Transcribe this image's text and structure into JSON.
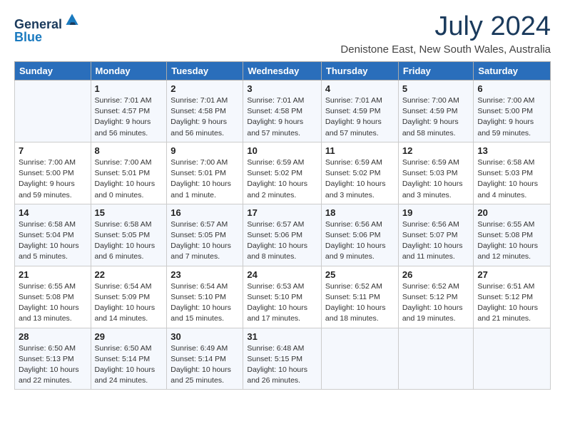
{
  "header": {
    "logo_line1": "General",
    "logo_line2": "Blue",
    "month_title": "July 2024",
    "location": "Denistone East, New South Wales, Australia"
  },
  "weekdays": [
    "Sunday",
    "Monday",
    "Tuesday",
    "Wednesday",
    "Thursday",
    "Friday",
    "Saturday"
  ],
  "weeks": [
    [
      {
        "day": "",
        "sunrise": "",
        "sunset": "",
        "daylight": ""
      },
      {
        "day": "1",
        "sunrise": "Sunrise: 7:01 AM",
        "sunset": "Sunset: 4:57 PM",
        "daylight": "Daylight: 9 hours and 56 minutes."
      },
      {
        "day": "2",
        "sunrise": "Sunrise: 7:01 AM",
        "sunset": "Sunset: 4:58 PM",
        "daylight": "Daylight: 9 hours and 56 minutes."
      },
      {
        "day": "3",
        "sunrise": "Sunrise: 7:01 AM",
        "sunset": "Sunset: 4:58 PM",
        "daylight": "Daylight: 9 hours and 57 minutes."
      },
      {
        "day": "4",
        "sunrise": "Sunrise: 7:01 AM",
        "sunset": "Sunset: 4:59 PM",
        "daylight": "Daylight: 9 hours and 57 minutes."
      },
      {
        "day": "5",
        "sunrise": "Sunrise: 7:00 AM",
        "sunset": "Sunset: 4:59 PM",
        "daylight": "Daylight: 9 hours and 58 minutes."
      },
      {
        "day": "6",
        "sunrise": "Sunrise: 7:00 AM",
        "sunset": "Sunset: 5:00 PM",
        "daylight": "Daylight: 9 hours and 59 minutes."
      }
    ],
    [
      {
        "day": "7",
        "sunrise": "Sunrise: 7:00 AM",
        "sunset": "Sunset: 5:00 PM",
        "daylight": "Daylight: 9 hours and 59 minutes."
      },
      {
        "day": "8",
        "sunrise": "Sunrise: 7:00 AM",
        "sunset": "Sunset: 5:01 PM",
        "daylight": "Daylight: 10 hours and 0 minutes."
      },
      {
        "day": "9",
        "sunrise": "Sunrise: 7:00 AM",
        "sunset": "Sunset: 5:01 PM",
        "daylight": "Daylight: 10 hours and 1 minute."
      },
      {
        "day": "10",
        "sunrise": "Sunrise: 6:59 AM",
        "sunset": "Sunset: 5:02 PM",
        "daylight": "Daylight: 10 hours and 2 minutes."
      },
      {
        "day": "11",
        "sunrise": "Sunrise: 6:59 AM",
        "sunset": "Sunset: 5:02 PM",
        "daylight": "Daylight: 10 hours and 3 minutes."
      },
      {
        "day": "12",
        "sunrise": "Sunrise: 6:59 AM",
        "sunset": "Sunset: 5:03 PM",
        "daylight": "Daylight: 10 hours and 3 minutes."
      },
      {
        "day": "13",
        "sunrise": "Sunrise: 6:58 AM",
        "sunset": "Sunset: 5:03 PM",
        "daylight": "Daylight: 10 hours and 4 minutes."
      }
    ],
    [
      {
        "day": "14",
        "sunrise": "Sunrise: 6:58 AM",
        "sunset": "Sunset: 5:04 PM",
        "daylight": "Daylight: 10 hours and 5 minutes."
      },
      {
        "day": "15",
        "sunrise": "Sunrise: 6:58 AM",
        "sunset": "Sunset: 5:05 PM",
        "daylight": "Daylight: 10 hours and 6 minutes."
      },
      {
        "day": "16",
        "sunrise": "Sunrise: 6:57 AM",
        "sunset": "Sunset: 5:05 PM",
        "daylight": "Daylight: 10 hours and 7 minutes."
      },
      {
        "day": "17",
        "sunrise": "Sunrise: 6:57 AM",
        "sunset": "Sunset: 5:06 PM",
        "daylight": "Daylight: 10 hours and 8 minutes."
      },
      {
        "day": "18",
        "sunrise": "Sunrise: 6:56 AM",
        "sunset": "Sunset: 5:06 PM",
        "daylight": "Daylight: 10 hours and 9 minutes."
      },
      {
        "day": "19",
        "sunrise": "Sunrise: 6:56 AM",
        "sunset": "Sunset: 5:07 PM",
        "daylight": "Daylight: 10 hours and 11 minutes."
      },
      {
        "day": "20",
        "sunrise": "Sunrise: 6:55 AM",
        "sunset": "Sunset: 5:08 PM",
        "daylight": "Daylight: 10 hours and 12 minutes."
      }
    ],
    [
      {
        "day": "21",
        "sunrise": "Sunrise: 6:55 AM",
        "sunset": "Sunset: 5:08 PM",
        "daylight": "Daylight: 10 hours and 13 minutes."
      },
      {
        "day": "22",
        "sunrise": "Sunrise: 6:54 AM",
        "sunset": "Sunset: 5:09 PM",
        "daylight": "Daylight: 10 hours and 14 minutes."
      },
      {
        "day": "23",
        "sunrise": "Sunrise: 6:54 AM",
        "sunset": "Sunset: 5:10 PM",
        "daylight": "Daylight: 10 hours and 15 minutes."
      },
      {
        "day": "24",
        "sunrise": "Sunrise: 6:53 AM",
        "sunset": "Sunset: 5:10 PM",
        "daylight": "Daylight: 10 hours and 17 minutes."
      },
      {
        "day": "25",
        "sunrise": "Sunrise: 6:52 AM",
        "sunset": "Sunset: 5:11 PM",
        "daylight": "Daylight: 10 hours and 18 minutes."
      },
      {
        "day": "26",
        "sunrise": "Sunrise: 6:52 AM",
        "sunset": "Sunset: 5:12 PM",
        "daylight": "Daylight: 10 hours and 19 minutes."
      },
      {
        "day": "27",
        "sunrise": "Sunrise: 6:51 AM",
        "sunset": "Sunset: 5:12 PM",
        "daylight": "Daylight: 10 hours and 21 minutes."
      }
    ],
    [
      {
        "day": "28",
        "sunrise": "Sunrise: 6:50 AM",
        "sunset": "Sunset: 5:13 PM",
        "daylight": "Daylight: 10 hours and 22 minutes."
      },
      {
        "day": "29",
        "sunrise": "Sunrise: 6:50 AM",
        "sunset": "Sunset: 5:14 PM",
        "daylight": "Daylight: 10 hours and 24 minutes."
      },
      {
        "day": "30",
        "sunrise": "Sunrise: 6:49 AM",
        "sunset": "Sunset: 5:14 PM",
        "daylight": "Daylight: 10 hours and 25 minutes."
      },
      {
        "day": "31",
        "sunrise": "Sunrise: 6:48 AM",
        "sunset": "Sunset: 5:15 PM",
        "daylight": "Daylight: 10 hours and 26 minutes."
      },
      {
        "day": "",
        "sunrise": "",
        "sunset": "",
        "daylight": ""
      },
      {
        "day": "",
        "sunrise": "",
        "sunset": "",
        "daylight": ""
      },
      {
        "day": "",
        "sunrise": "",
        "sunset": "",
        "daylight": ""
      }
    ]
  ]
}
